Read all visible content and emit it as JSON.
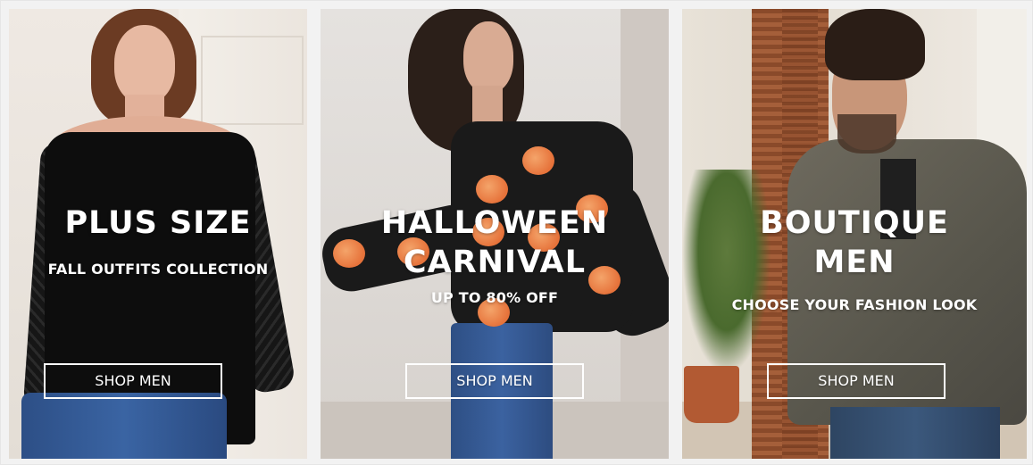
{
  "banners": [
    {
      "title_lines": [
        "PLUS SIZE"
      ],
      "subtitle": "FALL OUTFITS  COLLECTION",
      "button_label": "SHOP MEN"
    },
    {
      "title_lines": [
        "HALLOWEEN",
        "CARNIVAL"
      ],
      "subtitle": "UP TO 80% OFF",
      "button_label": "SHOP MEN"
    },
    {
      "title_lines": [
        "BOUTIQUE",
        "MEN"
      ],
      "subtitle": "CHOOSE YOUR FASHION LOOK",
      "button_label": "SHOP MEN"
    }
  ],
  "colors": {
    "text": "#ffffff",
    "frame_background": "#f2f2f2"
  }
}
